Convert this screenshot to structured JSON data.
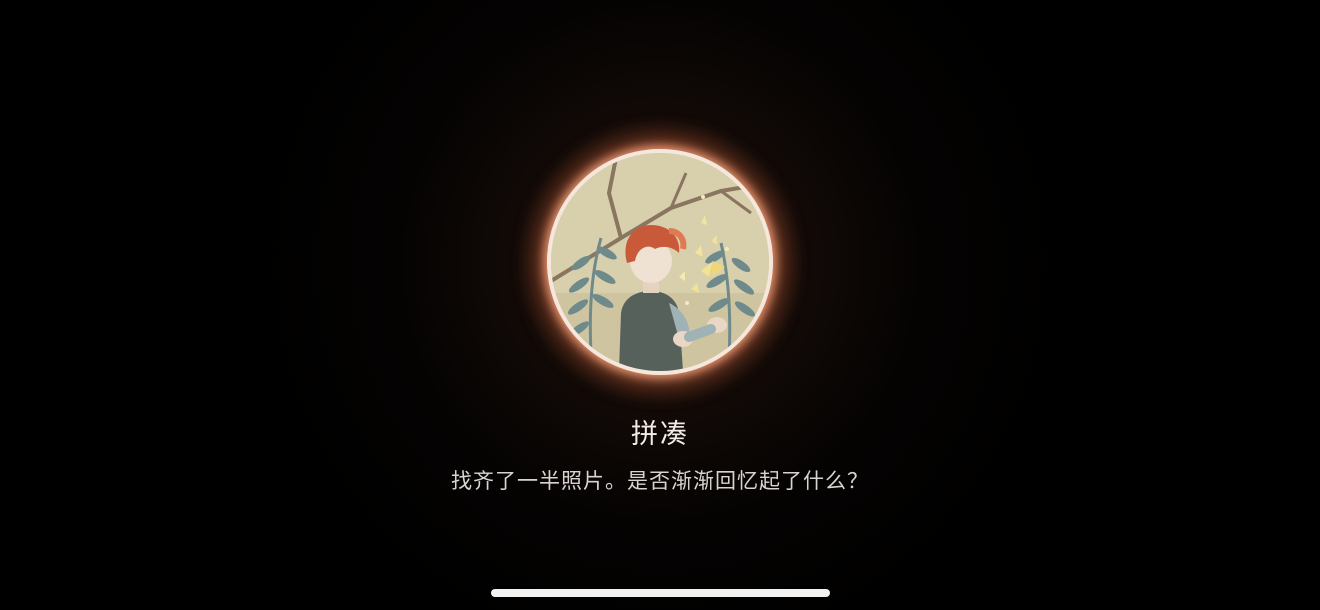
{
  "achievement": {
    "title": "拼凑",
    "description": "找齐了一半照片。是否渐渐回忆起了什么？",
    "icon": "boy-with-butterfly-medal-icon",
    "glow_color": "#f0a07a",
    "ring_color": "#f6e7dc"
  },
  "system": {
    "home_indicator": "home-indicator-bar"
  }
}
